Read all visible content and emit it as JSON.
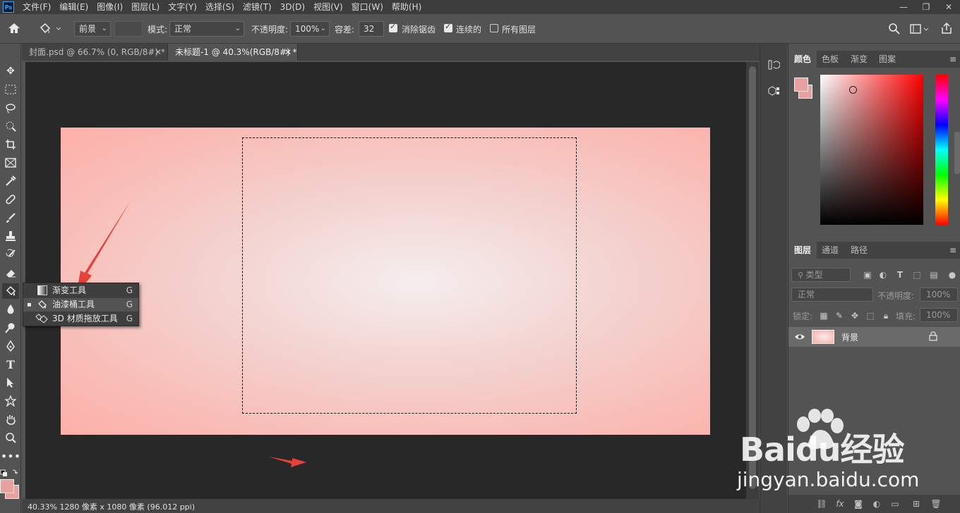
{
  "menubar": {
    "app_icon": "Ps",
    "items": [
      "文件(F)",
      "编辑(E)",
      "图像(I)",
      "图层(L)",
      "文字(Y)",
      "选择(S)",
      "滤镜(T)",
      "3D(D)",
      "视图(V)",
      "窗口(W)",
      "帮助(H)"
    ]
  },
  "options": {
    "fill_source": "前景",
    "mode_label": "模式:",
    "mode_value": "正常",
    "opacity_label": "不透明度:",
    "opacity_value": "100%",
    "tolerance_label": "容差:",
    "tolerance_value": "32",
    "antialias_label": "消除锯齿",
    "antialias_checked": true,
    "contiguous_label": "连续的",
    "contiguous_checked": true,
    "all_layers_label": "所有图层",
    "all_layers_checked": false
  },
  "tabs": [
    {
      "label": "封面.psd @ 66.7% (0, RGB/8#) *",
      "active": false
    },
    {
      "label": "未标题-1 @ 40.3%(RGB/8#) *",
      "active": true
    }
  ],
  "flyout": {
    "items": [
      {
        "label": "渐变工具",
        "key": "G",
        "selected": false,
        "icon": "gradient-icon"
      },
      {
        "label": "油漆桶工具",
        "key": "G",
        "selected": true,
        "icon": "paint-bucket-icon"
      },
      {
        "label": "3D 材质拖放工具",
        "key": "G",
        "selected": false,
        "icon": "material-drop-icon"
      }
    ]
  },
  "status": {
    "text": "40.33%  1280 像素 x 1080 像素 (96.012 ppi)"
  },
  "color_panel": {
    "tabs": [
      "颜色",
      "色板",
      "渐变",
      "图案"
    ],
    "foreground": "#e7a29f",
    "background": "#e7a29f"
  },
  "layers_panel": {
    "tabs": [
      "图层",
      "通道",
      "路径"
    ],
    "filter_label": "类型",
    "blend_mode": "正常",
    "opacity_label": "不透明度:",
    "opacity_value": "100%",
    "lock_label": "锁定:",
    "fill_label": "填充:",
    "fill_value": "100%",
    "layers": [
      {
        "name": "背景",
        "visible": true,
        "locked": true
      }
    ]
  },
  "watermark": {
    "logo": "Baidu经验",
    "url": "jingyan.baidu.com"
  },
  "colors": {
    "accent_arrow": "#e8413c",
    "canvas_edge": "#fdb0a9",
    "canvas_center": "#f5eeee"
  }
}
